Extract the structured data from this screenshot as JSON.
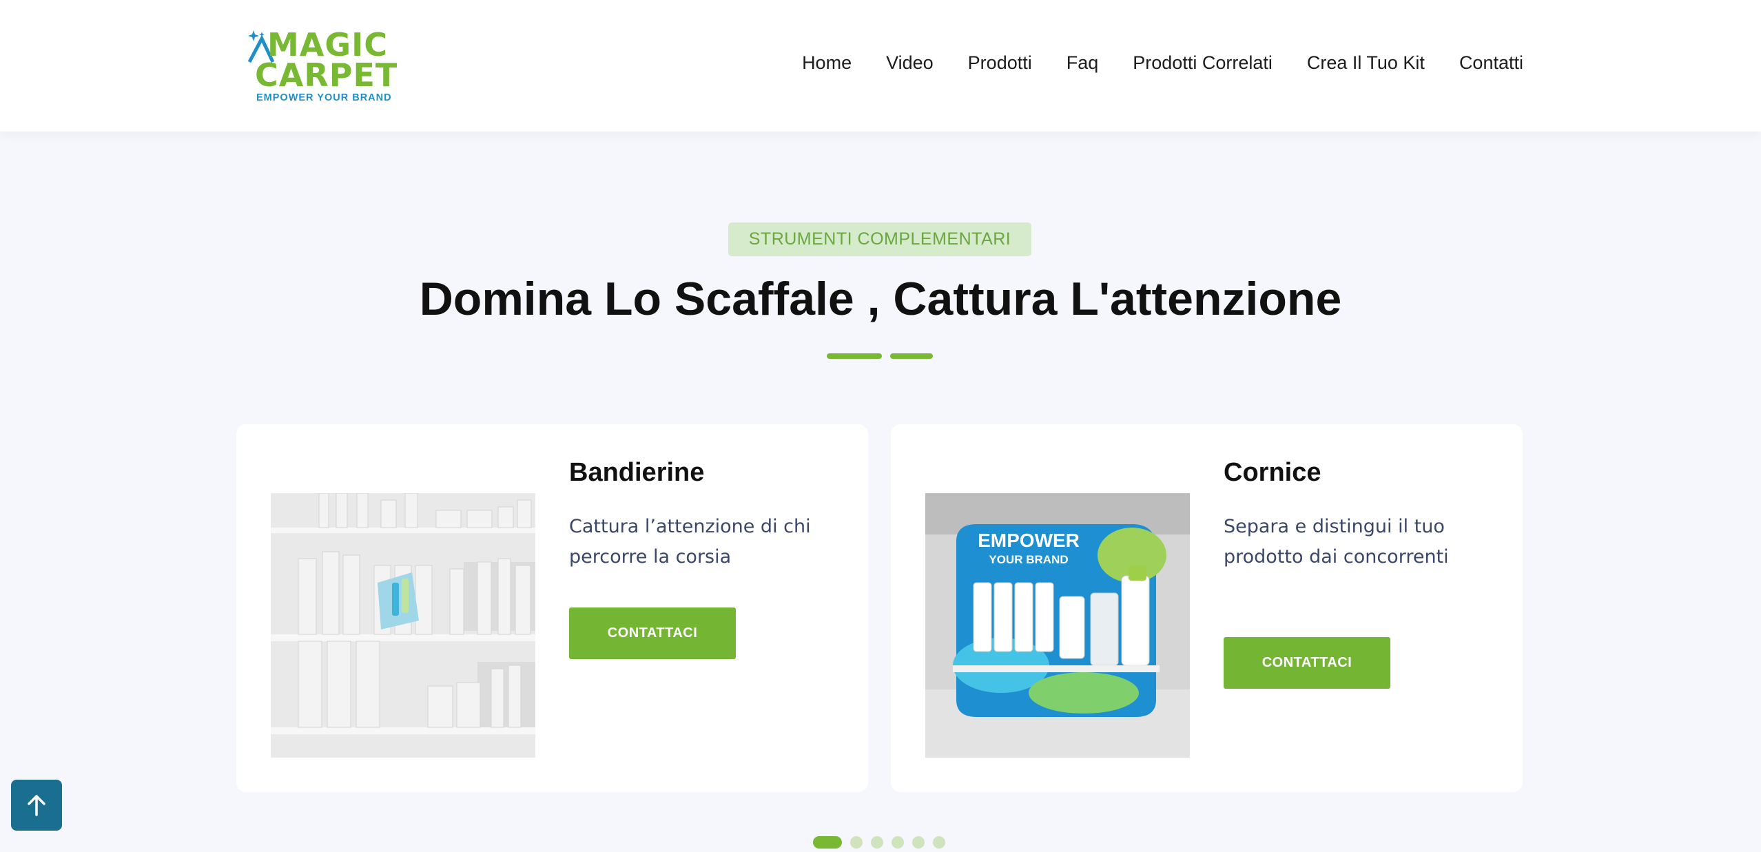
{
  "brand": {
    "logo_line1": "MAGIC",
    "logo_line2": "CARPET",
    "logo_tagline": "EMPOWER YOUR BRAND",
    "primary_color": "#78b833",
    "secondary_color": "#1f8fc9"
  },
  "nav": {
    "items": [
      "Home",
      "Video",
      "Prodotti",
      "Faq",
      "Prodotti Correlati",
      "Crea Il Tuo Kit",
      "Contatti"
    ]
  },
  "section": {
    "eyebrow": "STRUMENTI COMPLEMENTARI",
    "title": "Domina Lo Scaffale , Cattura L'attenzione"
  },
  "cards": [
    {
      "title": "Bandierine",
      "description": "Cattura l’attenzione di chi percorre la corsia",
      "button": "CONTATTACI",
      "image_icon": "shelf-with-flag-image"
    },
    {
      "title": "Cornice",
      "description": "Separa e distingui il tuo prodotto dai concorrenti",
      "button": "CONTATTACI",
      "image_icon": "shelf-frame-image",
      "image_text_line1": "EMPOWER",
      "image_text_line2": "YOUR BRAND"
    }
  ],
  "carousel": {
    "total_dots": 6,
    "active_index": 0
  },
  "back_to_top": {
    "icon": "arrow-up-icon"
  }
}
